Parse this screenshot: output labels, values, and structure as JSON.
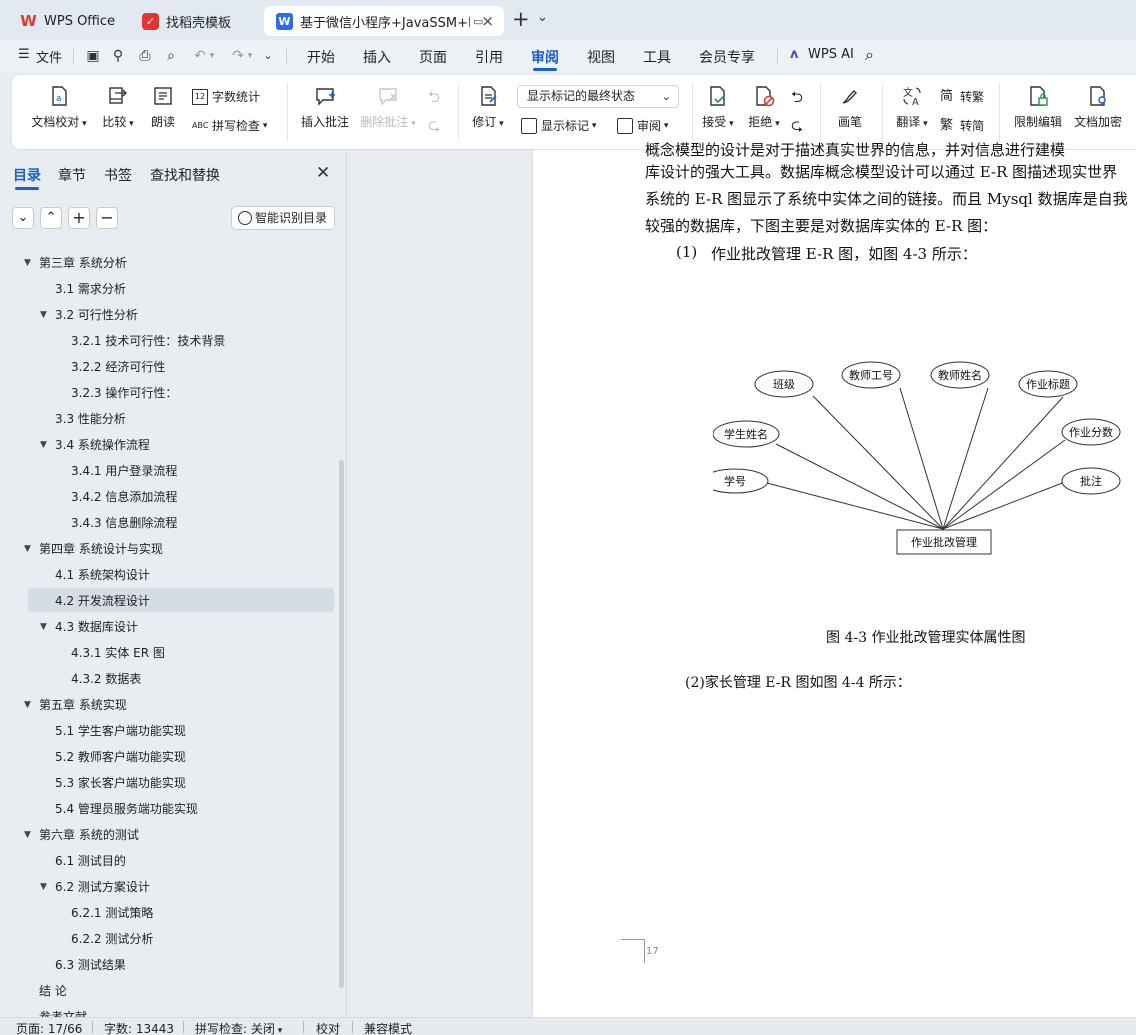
{
  "tabs": [
    {
      "label": "WPS Office",
      "icon": "wps-logo-icon"
    },
    {
      "label": "找稻壳模板",
      "icon": "docer-logo-icon"
    },
    {
      "label": "基于微信小程序+JavaSSM+M",
      "icon": "wps-writer-icon",
      "active": true
    }
  ],
  "tabbar": {
    "new_tab": "+",
    "dropdown": "⌄",
    "close": "×"
  },
  "menu": {
    "file": "文件",
    "items": [
      "开始",
      "插入",
      "页面",
      "引用",
      "审阅",
      "视图",
      "工具",
      "会员专享"
    ],
    "active": "审阅",
    "wps_ai": "WPS AI"
  },
  "ribbon": {
    "doc_check": "文档校对",
    "compare": "比较",
    "read_aloud": "朗读",
    "word_count": "字数统计",
    "spell_check": "拼写检查",
    "insert_comment": "插入批注",
    "delete_comment": "删除批注",
    "revise": "修订",
    "display_mode": "显示标记的最终状态",
    "show_markup": "显示标记",
    "review": "审阅",
    "accept": "接受",
    "reject": "拒绝",
    "pen": "画笔",
    "translate": "翻译",
    "to_traditional": "转繁",
    "to_simplified": "转简",
    "restrict_edit": "限制编辑",
    "encrypt": "文档加密"
  },
  "sidebar": {
    "tabs": [
      "目录",
      "章节",
      "书签",
      "查找和替换"
    ],
    "active_tab": "目录",
    "smart_toc": "智能识别目录",
    "toc": [
      {
        "text": "第三章  系统分析",
        "level": 1,
        "expanded": true
      },
      {
        "text": "3.1 需求分析",
        "level": 2
      },
      {
        "text": "3.2 可行性分析",
        "level": 2,
        "expanded": true
      },
      {
        "text": "3.2.1 技术可行性：技术背景",
        "level": 3
      },
      {
        "text": "3.2.2 经济可行性",
        "level": 3
      },
      {
        "text": "3.2.3 操作可行性：",
        "level": 3
      },
      {
        "text": "3.3 性能分析",
        "level": 2
      },
      {
        "text": "3.4 系统操作流程",
        "level": 2,
        "expanded": true
      },
      {
        "text": "3.4.1 用户登录流程",
        "level": 3
      },
      {
        "text": "3.4.2 信息添加流程",
        "level": 3
      },
      {
        "text": "3.4.3 信息删除流程",
        "level": 3
      },
      {
        "text": "第四章  系统设计与实现",
        "level": 1,
        "expanded": true
      },
      {
        "text": "4.1 系统架构设计",
        "level": 2
      },
      {
        "text": "4.2 开发流程设计",
        "level": 2,
        "selected": true
      },
      {
        "text": "4.3 数据库设计",
        "level": 2,
        "expanded": true
      },
      {
        "text": "4.3.1 实体 ER 图",
        "level": 3
      },
      {
        "text": "4.3.2 数据表",
        "level": 3
      },
      {
        "text": "第五章  系统实现",
        "level": 1,
        "expanded": true
      },
      {
        "text": "5.1 学生客户端功能实现",
        "level": 2
      },
      {
        "text": "5.2 教师客户端功能实现",
        "level": 2
      },
      {
        "text": "5.3 家长客户端功能实现",
        "level": 2
      },
      {
        "text": "5.4  管理员服务端功能实现",
        "level": 2
      },
      {
        "text": "第六章    系统的测试",
        "level": 1,
        "expanded": true
      },
      {
        "text": "6.1  测试目的",
        "level": 2
      },
      {
        "text": "6.2  测试方案设计",
        "level": 2,
        "expanded": true
      },
      {
        "text": "6.2.1  测试策略",
        "level": 3
      },
      {
        "text": "6.2.2  测试分析",
        "level": 3
      },
      {
        "text": "6.3  测试结果",
        "level": 2
      },
      {
        "text": "结    论",
        "level": 1
      },
      {
        "text": "参考文献",
        "level": 1
      }
    ]
  },
  "document": {
    "lines": [
      "库设计的强大工具。数据库概念模型设计可以通过 E-R 图描述现实世界",
      "系统的 E-R 图显示了系统中实体之间的链接。而且 Mysql 数据库是自我",
      "较强的数据库，下图主要是对数据库实体的 E-R 图："
    ],
    "item1_num": "(1)",
    "item1": "作业批改管理 E-R 图，如图 4-3 所示：",
    "figure_caption": "图 4-3  作业批改管理实体属性图",
    "item2": "(2)家长管理 E-R 图如图 4-4 所示：",
    "page_number": "17",
    "er": {
      "entity": "作业批改管理",
      "attributes": [
        "班级",
        "教师工号",
        "教师姓名",
        "作业标题",
        "学生姓名",
        "作业分数",
        "学号",
        "批注"
      ]
    }
  },
  "status": {
    "page": "页面: 17/66",
    "words": "字数: 13443",
    "spell": "拼写检查: 关闭",
    "proof": "校对",
    "compat": "兼容模式"
  }
}
